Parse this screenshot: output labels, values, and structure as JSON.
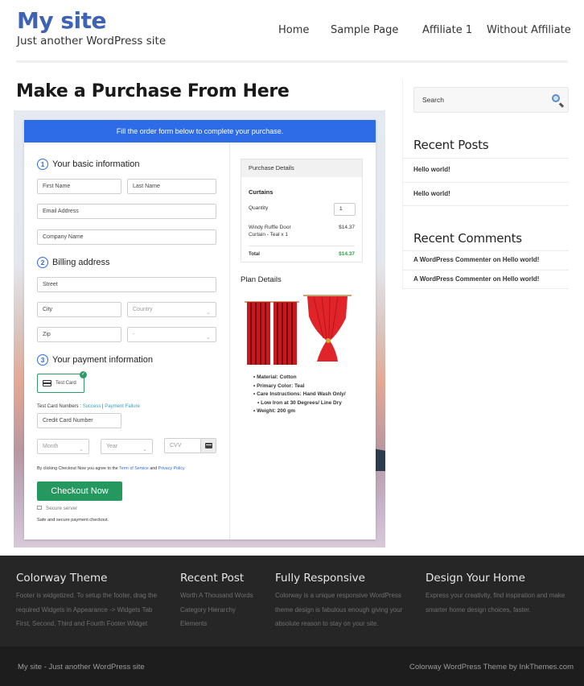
{
  "header": {
    "site_title": "My site",
    "tagline": "Just another WordPress site",
    "nav": [
      {
        "label": "Home"
      },
      {
        "label": "Sample Page"
      },
      {
        "label": "Affiliate 1"
      },
      {
        "label": "Without Affiliate"
      }
    ]
  },
  "page": {
    "title": "Make a Purchase From Here"
  },
  "form": {
    "banner": "Fill the order form below to complete your purchase.",
    "steps": [
      {
        "num": "1",
        "label": "Your basic information"
      },
      {
        "num": "2",
        "label": "Billing address"
      },
      {
        "num": "3",
        "label": "Your payment information"
      }
    ],
    "fields": {
      "first_name": "First Name",
      "last_name": "Last Name",
      "email": "Email Address",
      "company": "Company Name",
      "street": "Street",
      "city": "City",
      "country": "Country",
      "zip": "Zip",
      "state": "-",
      "card_number": "Credit Card Number",
      "month": "Month",
      "year": "Year",
      "cvv": "CVV"
    },
    "payment_method": "Test Card",
    "test_card_label": "Test Card Numbers : ",
    "test_success": "Success",
    "test_separator": " | ",
    "test_failure": "Payment Failure",
    "agree_prefix": "By clicking Checkout Now you agree to the ",
    "terms": "Term of Service",
    "agree_and": " and ",
    "privacy": "Privacy Policy",
    "checkout_button": "Checkout Now",
    "secure_server": "Secure server",
    "secure_note": "Safe and secure payment checkout."
  },
  "purchase": {
    "heading": "Purchase Details",
    "product_group": "Curtains",
    "quantity_label": "Quantity",
    "quantity_value": "1",
    "item_line1": "Windy Ruffle Door",
    "item_line2": "Curtain - Teal x 1",
    "item_price": "$14.37",
    "total_label": "Total",
    "total_value": "$14.37"
  },
  "plan": {
    "title": "Plan Details",
    "features": [
      "Material: Cotton",
      "Primary Color: Teal",
      "Care Instructions: Hand Wash Only/",
      "Low Iron at 30 Degrees/ Line Dry",
      "Weight: 200 gm"
    ]
  },
  "sidebar": {
    "search_placeholder": "Search",
    "recent_posts_title": "Recent Posts",
    "recent_posts": [
      "Hello world!",
      "Hello world!"
    ],
    "recent_comments_title": "Recent Comments",
    "recent_comments": [
      "A WordPress Commenter on Hello world!",
      "A WordPress Commenter on Hello world!"
    ]
  },
  "footer": {
    "columns": [
      {
        "title": "Colorway Theme",
        "lines": [
          "Footer is widgetized. To setup the footer, drag the",
          "required Widgets in Appearance -> Widgets Tab",
          "First, Second, Third and Fourth Footer Widget"
        ]
      },
      {
        "title": "Recent Post",
        "lines": [
          "Worth A Thousand Words",
          "Category Hierarchy",
          "Elements"
        ]
      },
      {
        "title": "Fully Responsive",
        "lines": [
          "Colorway is a unique responsive WordPress",
          "theme design is fabulous enough giving your",
          "absolute reason to stay on your site."
        ]
      },
      {
        "title": "Design Your Home",
        "lines": [
          "Express your creativity, find inspiration and make",
          "smarter home design choices, faster."
        ]
      }
    ],
    "bottom_left": "My site - Just another WordPress site",
    "bottom_right": "Colorway WordPress Theme by InkThemes.com"
  },
  "colors": {
    "brand": "#3d63b4",
    "banner": "#2e6be6",
    "checkout": "#24985f",
    "total": "#2e9a4b"
  }
}
